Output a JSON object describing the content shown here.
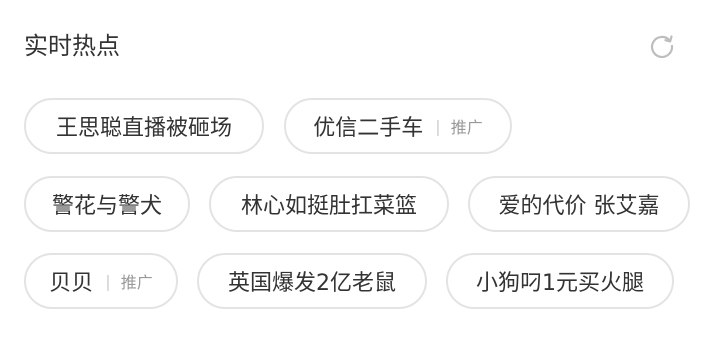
{
  "header": {
    "title": "实时热点",
    "refresh_icon": "refresh-icon"
  },
  "colors": {
    "chip_border": "#e3e3e3",
    "text": "#333333",
    "muted": "#999999"
  },
  "chips": [
    {
      "label": "王思聪直播被砸场"
    },
    {
      "label": "优信二手车",
      "ad": "推广",
      "sep": "|"
    },
    {
      "label": "警花与警犬"
    },
    {
      "label": "林心如挺肚扛菜篮"
    },
    {
      "label": "爱的代价 张艾嘉"
    },
    {
      "label": "贝贝",
      "ad": "推广",
      "sep": "|"
    },
    {
      "label": "英国爆发2亿老鼠"
    },
    {
      "label": "小狗叼1元买火腿"
    }
  ]
}
